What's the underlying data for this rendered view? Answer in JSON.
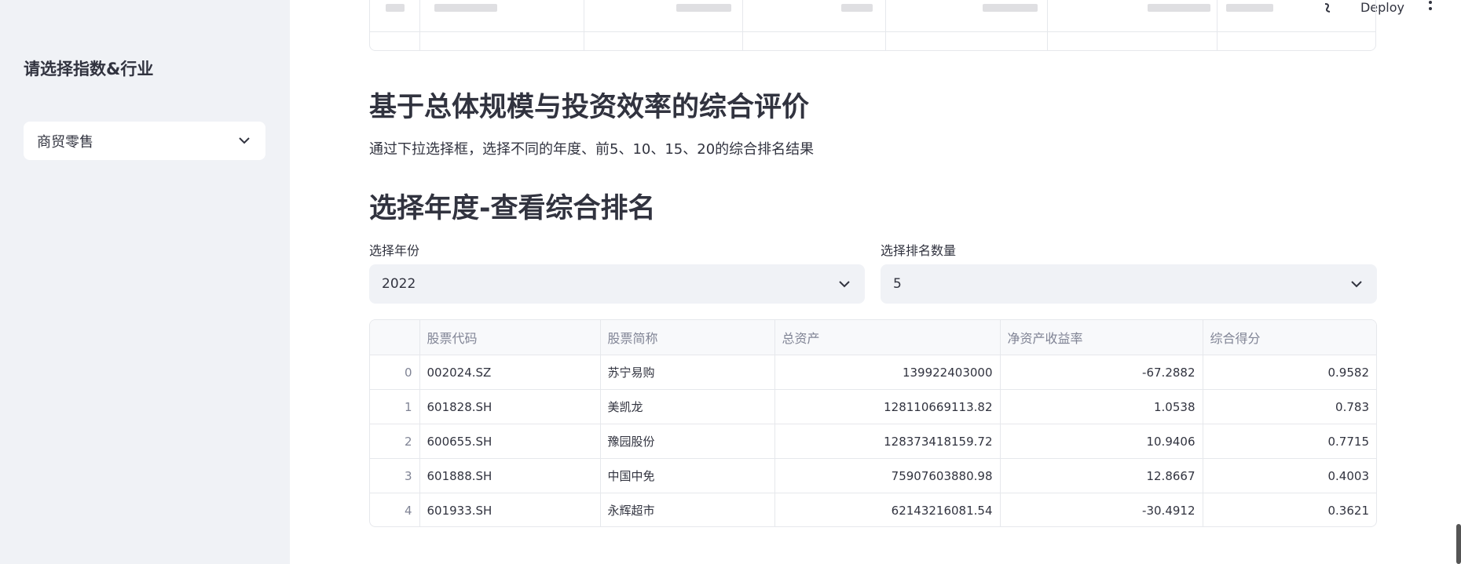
{
  "sidebar": {
    "title": "请选择指数&行业",
    "select_value": "商贸零售"
  },
  "header": {
    "deploy_label": "Deploy"
  },
  "main": {
    "heading": "基于总体规模与投资效率的综合评价",
    "description": "通过下拉选择框，选择不同的年度、前5、10、15、20的综合排名结果",
    "subheading": "选择年度-查看综合排名",
    "year_label": "选择年份",
    "year_value": "2022",
    "count_label": "选择排名数量",
    "count_value": "5"
  },
  "table": {
    "columns": [
      "",
      "股票代码",
      "股票简称",
      "总资产",
      "净资产收益率",
      "综合得分"
    ],
    "rows": [
      [
        "0",
        "002024.SZ",
        "苏宁易购",
        "139922403000",
        "-67.2882",
        "0.9582"
      ],
      [
        "1",
        "601828.SH",
        "美凯龙",
        "128110669113.82",
        "1.0538",
        "0.783"
      ],
      [
        "2",
        "600655.SH",
        "豫园股份",
        "128373418159.72",
        "10.9406",
        "0.7715"
      ],
      [
        "3",
        "601888.SH",
        "中国中免",
        "75907603880.98",
        "12.8667",
        "0.4003"
      ],
      [
        "4",
        "601933.SH",
        "永辉超市",
        "62143216081.54",
        "-30.4912",
        "0.3621"
      ]
    ]
  }
}
